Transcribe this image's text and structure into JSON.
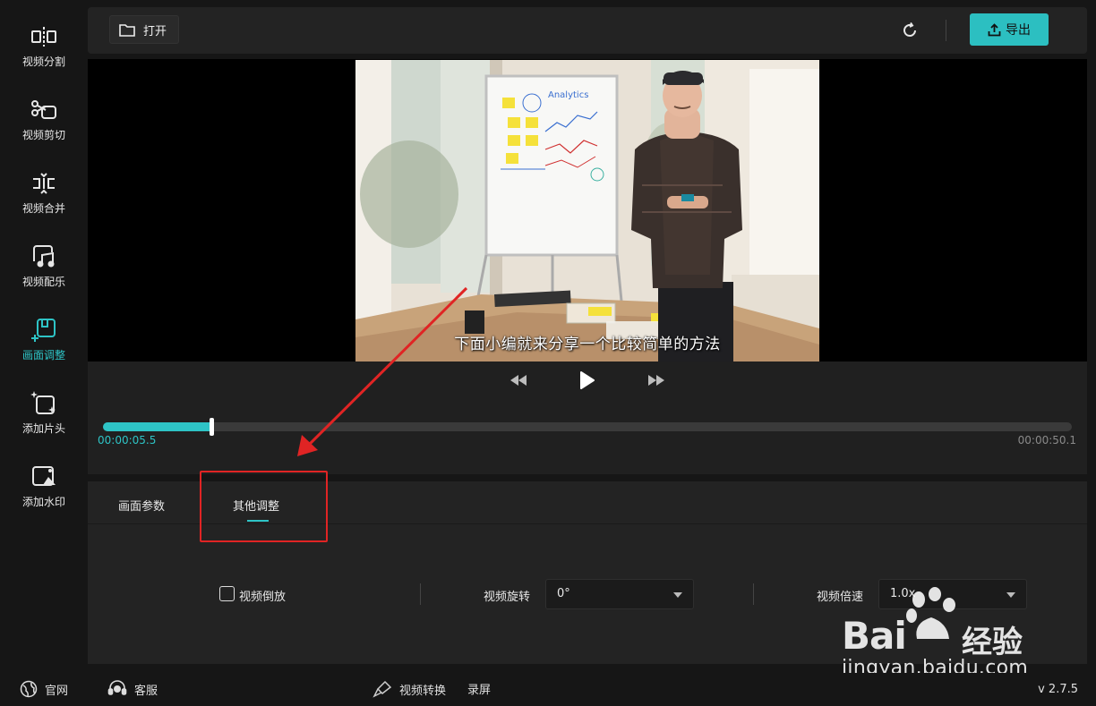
{
  "sidebar": {
    "items": [
      {
        "label": "视频分割",
        "icon": "split-icon"
      },
      {
        "label": "视频剪切",
        "icon": "scissors-icon"
      },
      {
        "label": "视频合并",
        "icon": "merge-icon"
      },
      {
        "label": "视频配乐",
        "icon": "music-icon"
      },
      {
        "label": "画面调整",
        "icon": "crop-adjust-icon",
        "active": true
      },
      {
        "label": "添加片头",
        "icon": "add-intro-icon"
      },
      {
        "label": "添加水印",
        "icon": "watermark-image-icon"
      }
    ]
  },
  "toolbar": {
    "open_label": "打开",
    "export_label": "导出",
    "accent": "#2cbfc1"
  },
  "player": {
    "subtitle": "下面小编就来分享一个比较简单的方法",
    "current_time": "00:00:05.5",
    "total_time": "00:00:50.1",
    "progress": 0.11,
    "whiteboard_text": "Analytics"
  },
  "settings": {
    "tabs": [
      {
        "label": "画面参数"
      },
      {
        "label": "其他调整",
        "active": true
      }
    ],
    "reverse_label": "视频倒放",
    "rotate_label": "视频旋转",
    "rotate_value": "0°",
    "speed_label": "视频倍速",
    "speed_value": "1.0x"
  },
  "footer": {
    "website_label": "官网",
    "support_label": "客服",
    "convert_label": "视频转换",
    "record_label": "录屏",
    "version": "v 2.7.5"
  },
  "watermark": {
    "brand": "Bai",
    "brand_cn": "经验",
    "url": "jingyan.baidu.com"
  },
  "annotation_color": "#e02424"
}
